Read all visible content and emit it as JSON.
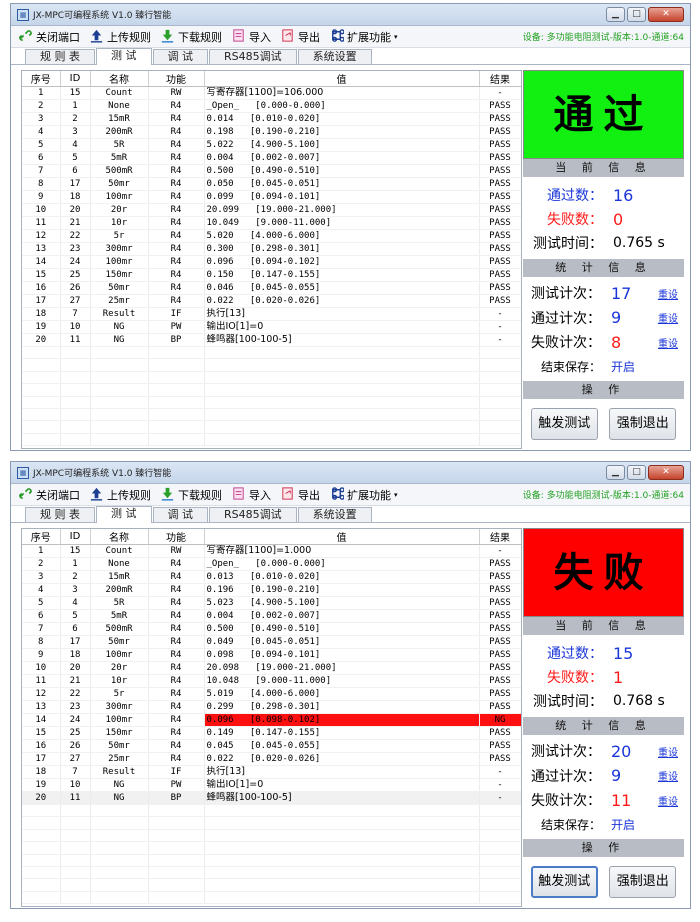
{
  "windows": [
    {
      "title": "JX-MPC可编程系统 V1.0 臻行智能",
      "toolbar": {
        "close_port": "关闭端口",
        "upload": "上传规则",
        "download": "下载规则",
        "import": "导入",
        "export": "导出",
        "extend": "扩展功能"
      },
      "device_info": "设备: 多功能电阻测试-版本:1.0-通道:64",
      "tabs": [
        "规 则 表",
        "测 试",
        "调 试",
        "RS485调试",
        "系统设置"
      ],
      "active_tab": 1,
      "columns": [
        "序号",
        "ID",
        "名称",
        "功能",
        "值",
        "结果"
      ],
      "rows": [
        [
          "1",
          "15",
          "Count",
          "RW",
          "写寄存器[1100]=106.000",
          "-"
        ],
        [
          "2",
          "1",
          "None",
          "R4",
          "_Open_   [0.000-0.000]",
          "PASS"
        ],
        [
          "3",
          "2",
          "15mR",
          "R4",
          "0.014   [0.010-0.020]",
          "PASS"
        ],
        [
          "4",
          "3",
          "200mR",
          "R4",
          "0.198   [0.190-0.210]",
          "PASS"
        ],
        [
          "5",
          "4",
          "5R",
          "R4",
          "5.022   [4.900-5.100]",
          "PASS"
        ],
        [
          "6",
          "5",
          "5mR",
          "R4",
          "0.004   [0.002-0.007]",
          "PASS"
        ],
        [
          "7",
          "6",
          "500mR",
          "R4",
          "0.500   [0.490-0.510]",
          "PASS"
        ],
        [
          "8",
          "17",
          "50mr",
          "R4",
          "0.050   [0.045-0.051]",
          "PASS"
        ],
        [
          "9",
          "18",
          "100mr",
          "R4",
          "0.099   [0.094-0.101]",
          "PASS"
        ],
        [
          "10",
          "20",
          "20r",
          "R4",
          "20.099   [19.000-21.000]",
          "PASS"
        ],
        [
          "11",
          "21",
          "10r",
          "R4",
          "10.049   [9.000-11.000]",
          "PASS"
        ],
        [
          "12",
          "22",
          "5r",
          "R4",
          "5.020   [4.000-6.000]",
          "PASS"
        ],
        [
          "13",
          "23",
          "300mr",
          "R4",
          "0.300   [0.298-0.301]",
          "PASS"
        ],
        [
          "14",
          "24",
          "100mr",
          "R4",
          "0.096   [0.094-0.102]",
          "PASS"
        ],
        [
          "15",
          "25",
          "150mr",
          "R4",
          "0.150   [0.147-0.155]",
          "PASS"
        ],
        [
          "16",
          "26",
          "50mr",
          "R4",
          "0.046   [0.045-0.055]",
          "PASS"
        ],
        [
          "17",
          "27",
          "25mr",
          "R4",
          "0.022   [0.020-0.026]",
          "PASS"
        ],
        [
          "18",
          "7",
          "Result",
          "IF",
          "执行[13]",
          "-"
        ],
        [
          "19",
          "10",
          "NG",
          "PW",
          "输出IO[1]=0",
          "-"
        ],
        [
          "20",
          "11",
          "NG",
          "BP",
          "蜂鸣器[100-100-5]",
          "-"
        ]
      ],
      "ng_row": -1,
      "selected_row": -1,
      "status": {
        "text": "通过",
        "kind": "pass"
      },
      "current_header": "当 前 信 息",
      "pass_label": "通过数：",
      "pass_count": "16",
      "fail_label": "失败数：",
      "fail_count": "0",
      "time_label": "测试时间：",
      "time_value": "0.765 s",
      "stats_header": "统 计 信 息",
      "test_count_label": "测试计次：",
      "test_count": "17",
      "pass_times_label": "通过计次：",
      "pass_times": "9",
      "fail_times_label": "失败计次：",
      "fail_times": "8",
      "reset_label": "重设",
      "save_label": "结束保存：",
      "save_value": "开启",
      "ops_header": "操 作",
      "trigger_label": "触发测试",
      "abort_label": "强制退出",
      "trigger_focused": false
    },
    {
      "title": "JX-MPC可编程系统 V1.0 臻行智能",
      "toolbar": {
        "close_port": "关闭端口",
        "upload": "上传规则",
        "download": "下载规则",
        "import": "导入",
        "export": "导出",
        "extend": "扩展功能"
      },
      "device_info": "设备: 多功能电阻测试-版本:1.0-通道:64",
      "tabs": [
        "规 则 表",
        "测 试",
        "调 试",
        "RS485调试",
        "系统设置"
      ],
      "active_tab": 1,
      "columns": [
        "序号",
        "ID",
        "名称",
        "功能",
        "值",
        "结果"
      ],
      "rows": [
        [
          "1",
          "15",
          "Count",
          "RW",
          "写寄存器[1100]=1.000",
          "-"
        ],
        [
          "2",
          "1",
          "None",
          "R4",
          "_Open_   [0.000-0.000]",
          "PASS"
        ],
        [
          "3",
          "2",
          "15mR",
          "R4",
          "0.013   [0.010-0.020]",
          "PASS"
        ],
        [
          "4",
          "3",
          "200mR",
          "R4",
          "0.196   [0.190-0.210]",
          "PASS"
        ],
        [
          "5",
          "4",
          "5R",
          "R4",
          "5.023   [4.900-5.100]",
          "PASS"
        ],
        [
          "6",
          "5",
          "5mR",
          "R4",
          "0.004   [0.002-0.007]",
          "PASS"
        ],
        [
          "7",
          "6",
          "500mR",
          "R4",
          "0.500   [0.490-0.510]",
          "PASS"
        ],
        [
          "8",
          "17",
          "50mr",
          "R4",
          "0.049   [0.045-0.051]",
          "PASS"
        ],
        [
          "9",
          "18",
          "100mr",
          "R4",
          "0.098   [0.094-0.101]",
          "PASS"
        ],
        [
          "10",
          "20",
          "20r",
          "R4",
          "20.098   [19.000-21.000]",
          "PASS"
        ],
        [
          "11",
          "21",
          "10r",
          "R4",
          "10.048   [9.000-11.000]",
          "PASS"
        ],
        [
          "12",
          "22",
          "5r",
          "R4",
          "5.019   [4.000-6.000]",
          "PASS"
        ],
        [
          "13",
          "23",
          "300mr",
          "R4",
          "0.299   [0.298-0.301]",
          "PASS"
        ],
        [
          "14",
          "24",
          "100mr",
          "R4",
          "0.096   [0.098-0.102]",
          "NG"
        ],
        [
          "15",
          "25",
          "150mr",
          "R4",
          "0.149   [0.147-0.155]",
          "PASS"
        ],
        [
          "16",
          "26",
          "50mr",
          "R4",
          "0.045   [0.045-0.055]",
          "PASS"
        ],
        [
          "17",
          "27",
          "25mr",
          "R4",
          "0.022   [0.020-0.026]",
          "PASS"
        ],
        [
          "18",
          "7",
          "Result",
          "IF",
          "执行[13]",
          "-"
        ],
        [
          "19",
          "10",
          "NG",
          "PW",
          "输出IO[1]=0",
          "-"
        ],
        [
          "20",
          "11",
          "NG",
          "BP",
          "蜂鸣器[100-100-5]",
          "-"
        ]
      ],
      "ng_row": 13,
      "selected_row": 19,
      "status": {
        "text": "失败",
        "kind": "fail"
      },
      "current_header": "当 前 信 息",
      "pass_label": "通过数：",
      "pass_count": "15",
      "fail_label": "失败数：",
      "fail_count": "1",
      "time_label": "测试时间：",
      "time_value": "0.768 s",
      "stats_header": "统 计 信 息",
      "test_count_label": "测试计次：",
      "test_count": "20",
      "pass_times_label": "通过计次：",
      "pass_times": "9",
      "fail_times_label": "失败计次：",
      "fail_times": "11",
      "reset_label": "重设",
      "save_label": "结束保存：",
      "save_value": "开启",
      "ops_header": "操 作",
      "trigger_label": "触发测试",
      "abort_label": "强制退出",
      "trigger_focused": true
    }
  ],
  "colors": {
    "pass": "#11f011",
    "fail": "#ff0000",
    "ng_row": "#ff1010",
    "device_info": "#22a022",
    "accent_blue": "#1a35d8"
  }
}
